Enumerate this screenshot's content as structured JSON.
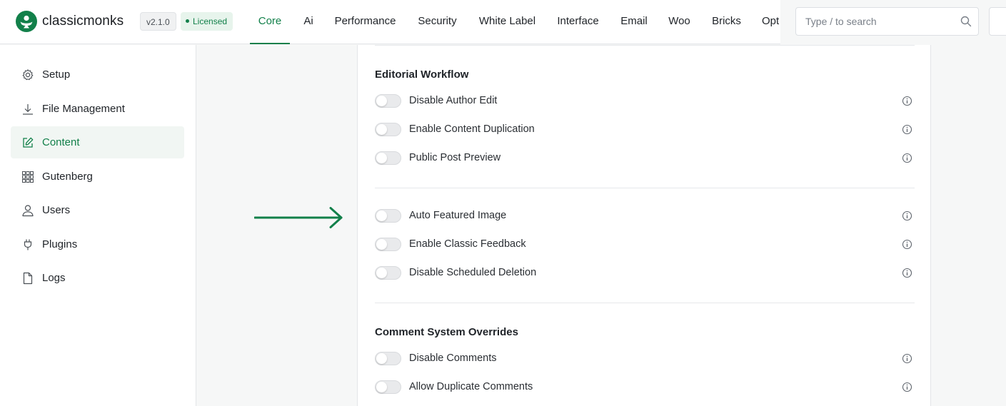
{
  "brand": {
    "name": "classicmonks",
    "version": "v2.1.0",
    "license_status": "Licensed",
    "accent": "#12804a"
  },
  "nav": {
    "active": "Core",
    "items": [
      "Core",
      "Ai",
      "Performance",
      "Security",
      "White Label",
      "Interface",
      "Email",
      "Woo",
      "Bricks",
      "Opt"
    ]
  },
  "search": {
    "placeholder": "Type / to search"
  },
  "sidebar": {
    "items": [
      {
        "label": "Setup",
        "icon": "gear-icon"
      },
      {
        "label": "File Management",
        "icon": "download-icon"
      },
      {
        "label": "Content",
        "icon": "edit-icon",
        "active": true
      },
      {
        "label": "Gutenberg",
        "icon": "grid-icon"
      },
      {
        "label": "Users",
        "icon": "user-icon"
      },
      {
        "label": "Plugins",
        "icon": "plug-icon"
      },
      {
        "label": "Logs",
        "icon": "file-icon"
      }
    ]
  },
  "sections": [
    {
      "title": "Editorial Workflow",
      "options": [
        {
          "label": "Disable Author Edit",
          "enabled": false
        },
        {
          "label": "Enable Content Duplication",
          "enabled": false
        },
        {
          "label": "Public Post Preview",
          "enabled": false
        }
      ]
    },
    {
      "title": "",
      "options": [
        {
          "label": "Auto Featured Image",
          "enabled": false
        },
        {
          "label": "Enable Classic Feedback",
          "enabled": false
        },
        {
          "label": "Disable Scheduled Deletion",
          "enabled": false
        }
      ]
    },
    {
      "title": "Comment System Overrides",
      "options": [
        {
          "label": "Disable Comments",
          "enabled": false
        },
        {
          "label": "Allow Duplicate Comments",
          "enabled": false
        }
      ]
    }
  ]
}
